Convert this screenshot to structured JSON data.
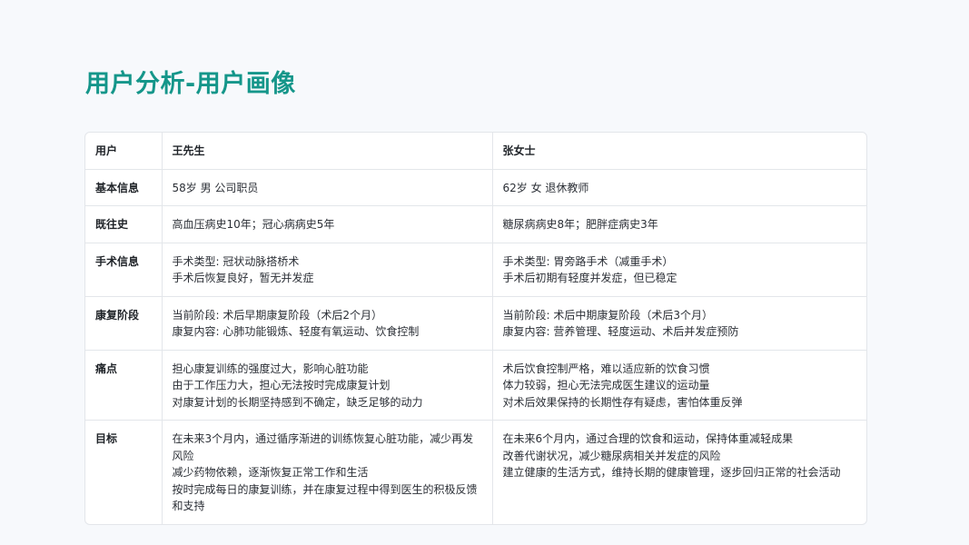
{
  "page": {
    "title": "用户分析-用户画像"
  },
  "table": {
    "header": {
      "label": "用户",
      "user_a": "王先生",
      "user_b": "张女士"
    },
    "rows": [
      {
        "label": "基本信息",
        "a": [
          "58岁 男 公司职员"
        ],
        "b": [
          "62岁 女 退休教师"
        ]
      },
      {
        "label": "既往史",
        "a": [
          "高血压病史10年；冠心病病史5年"
        ],
        "b": [
          "糖尿病病史8年；肥胖症病史3年"
        ]
      },
      {
        "label": "手术信息",
        "a": [
          "手术类型: 冠状动脉搭桥术",
          "手术后恢复良好，暂无并发症"
        ],
        "b": [
          "手术类型: 胃旁路手术（减重手术）",
          "手术后初期有轻度并发症，但已稳定"
        ]
      },
      {
        "label": "康复阶段",
        "a": [
          "当前阶段: 术后早期康复阶段（术后2个月）",
          "康复内容: 心肺功能锻炼、轻度有氧运动、饮食控制"
        ],
        "b": [
          "当前阶段: 术后中期康复阶段（术后3个月）",
          "康复内容: 营养管理、轻度运动、术后并发症预防"
        ]
      },
      {
        "label": "痛点",
        "a": [
          "担心康复训练的强度过大，影响心脏功能",
          "由于工作压力大，担心无法按时完成康复计划",
          "对康复计划的长期坚持感到不确定，缺乏足够的动力"
        ],
        "b": [
          "术后饮食控制严格，难以适应新的饮食习惯",
          "体力较弱，担心无法完成医生建议的运动量",
          "对术后效果保持的长期性存有疑虑，害怕体重反弹"
        ]
      },
      {
        "label": "目标",
        "a": [
          "在未来3个月内，通过循序渐进的训练恢复心脏功能，减少再发风险",
          "减少药物依赖，逐渐恢复正常工作和生活",
          "按时完成每日的康复训练，并在康复过程中得到医生的积极反馈和支持"
        ],
        "b": [
          "在未来6个月内，通过合理的饮食和运动，保持体重减轻成果",
          "改善代谢状况，减少糖尿病相关并发症的风险",
          "建立健康的生活方式，维持长期的健康管理，逐步回归正常的社会活动"
        ]
      }
    ]
  }
}
